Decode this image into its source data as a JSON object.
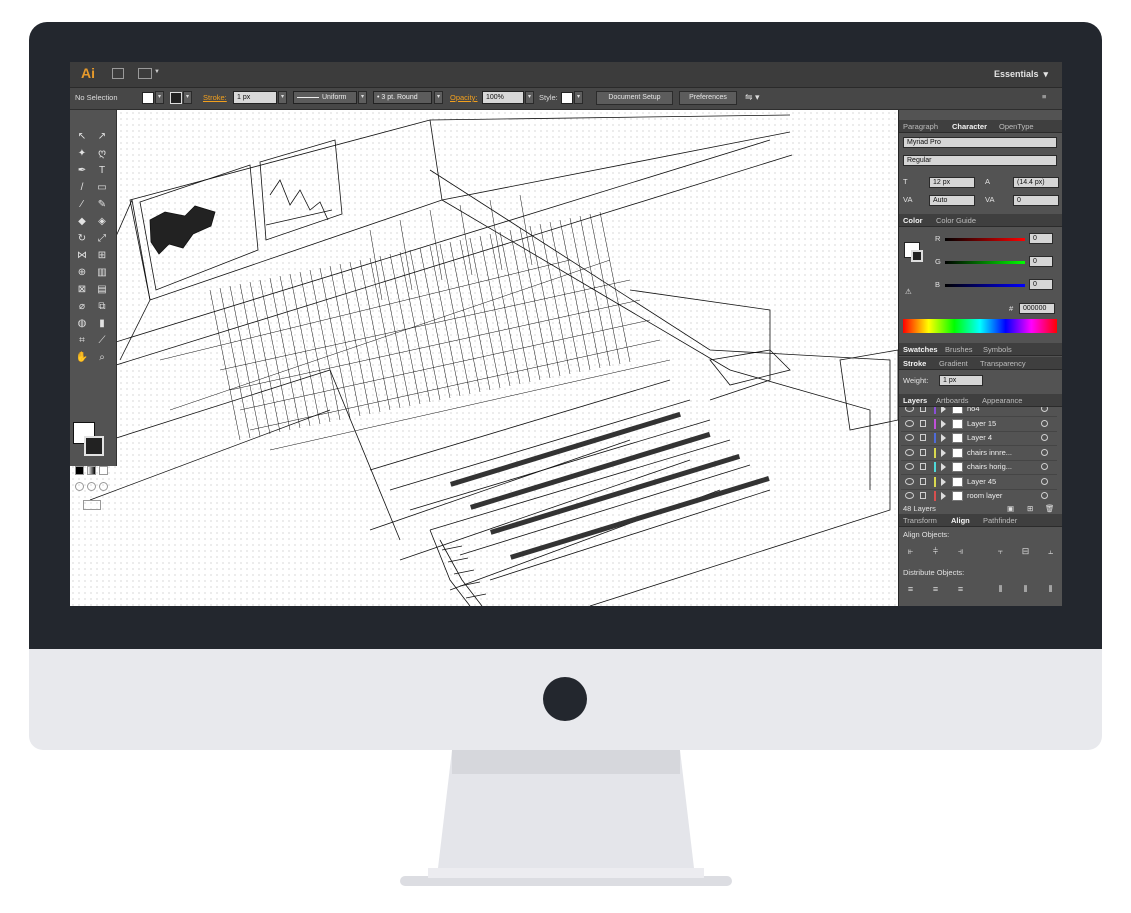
{
  "app": {
    "logo": "Ai",
    "workspace": "Essentials"
  },
  "colors": {
    "accent": "#e79a2b",
    "bezel": "#23272e",
    "chin": "#e8e9ed",
    "panel": "#535353"
  },
  "control_bar": {
    "selection": "No Selection",
    "stroke_label": "Stroke:",
    "stroke_weight": "1 px",
    "profile": "Uniform",
    "brush": "3 pt. Round",
    "opacity_label": "Opacity:",
    "opacity_value": "100%",
    "style_label": "Style:",
    "document_setup": "Document Setup",
    "preferences": "Preferences"
  },
  "character_panel": {
    "tabs": [
      "Paragraph",
      "Character",
      "OpenType"
    ],
    "font_family": "Myriad Pro",
    "font_style": "Regular",
    "font_size": "12 px",
    "leading": "(14.4 px)",
    "kerning": "Auto",
    "tracking": "0"
  },
  "color_panel": {
    "tabs": [
      "Color",
      "Color Guide"
    ],
    "r_label": "R",
    "g_label": "G",
    "b_label": "B",
    "r": "0",
    "g": "0",
    "b": "0",
    "hex_label": "#",
    "hex": "000000"
  },
  "swatches_panel": {
    "tabs": [
      "Swatches",
      "Brushes",
      "Symbols"
    ]
  },
  "stroke_panel": {
    "tabs": [
      "Stroke",
      "Gradient",
      "Transparency"
    ],
    "weight_label": "Weight:",
    "weight": "1 px"
  },
  "layers_panel": {
    "tabs": [
      "Layers",
      "Artboards",
      "Appearance"
    ],
    "layers": [
      {
        "name": "no4",
        "color": "#8a4fd8"
      },
      {
        "name": "Layer 15",
        "color": "#c04fd8"
      },
      {
        "name": "Layer 4",
        "color": "#4f6bd8"
      },
      {
        "name": "chairs innre...",
        "color": "#d8d84f"
      },
      {
        "name": "chairs horig...",
        "color": "#4fd8d8"
      },
      {
        "name": "Layer 45",
        "color": "#d8d84f"
      },
      {
        "name": "room layer",
        "color": "#d84f4f"
      }
    ],
    "count": "48 Layers"
  },
  "align_panel": {
    "tabs": [
      "Transform",
      "Align",
      "Pathfinder"
    ],
    "align_objects": "Align Objects:",
    "distribute_objects": "Distribute Objects:"
  }
}
